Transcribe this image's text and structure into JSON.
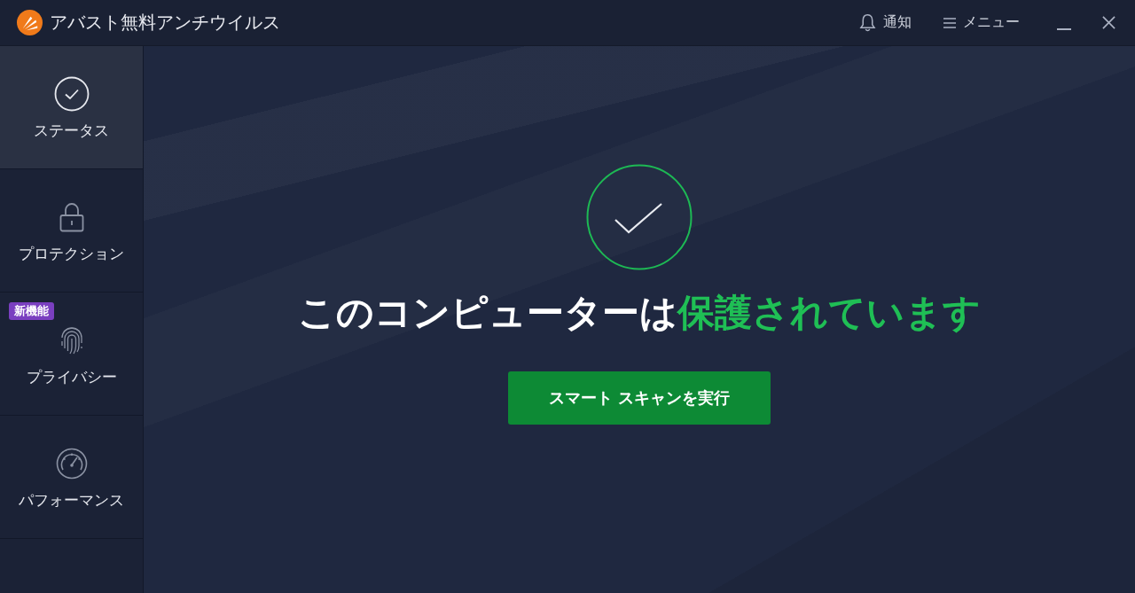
{
  "window": {
    "title": "アバスト無料アンチウイルス"
  },
  "header_actions": [
    {
      "label": "通知"
    },
    {
      "label": "メニュー"
    }
  ],
  "sidebar": {
    "items": [
      {
        "label": "ステータス",
        "selected": true
      },
      {
        "label": "プロテクション",
        "selected": false
      },
      {
        "label": "プライバシー",
        "selected": false,
        "badge": "新機能"
      },
      {
        "label": "パフォーマンス",
        "selected": false
      }
    ]
  },
  "status": {
    "message": "このコンピューターは",
    "highlight": "保護されています"
  },
  "primary_button": {
    "label": "スマート スキャンを実行"
  }
}
